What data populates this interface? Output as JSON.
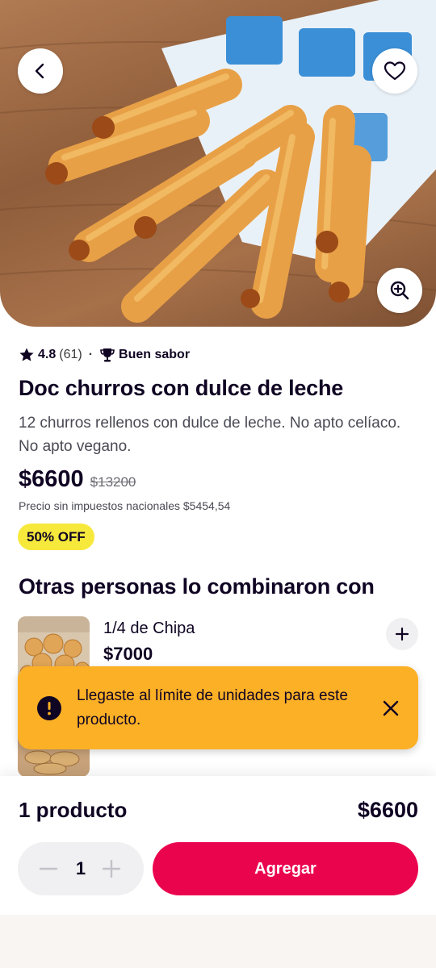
{
  "header": {
    "back_icon": "chevron-left-icon",
    "favorite_icon": "heart-icon",
    "zoom_icon": "zoom-in-icon"
  },
  "product": {
    "rating": "4.8",
    "reviews": "(61)",
    "rating_separator": "·",
    "quality_badge": "Buen sabor",
    "title": "Doc churros con dulce de leche",
    "description": "12 churros rellenos con dulce de leche. No apto celíaco. No apto vegano.",
    "price": "$6600",
    "old_price": "$13200",
    "tax_note": "Precio sin impuestos nacionales $5454,54",
    "discount_badge": "50% OFF"
  },
  "combo": {
    "title": "Otras personas lo combinaron con",
    "items": [
      {
        "name": "1/4 de Chipa",
        "price": "$7000"
      }
    ]
  },
  "toast": {
    "message": "Llegaste al límite de unidades para este producto.",
    "color": "#fcb025"
  },
  "footer": {
    "quantity_label": "1 producto",
    "total": "$6600",
    "stepper_value": "1",
    "add_label": "Agregar",
    "accent_color": "#ea044e"
  }
}
